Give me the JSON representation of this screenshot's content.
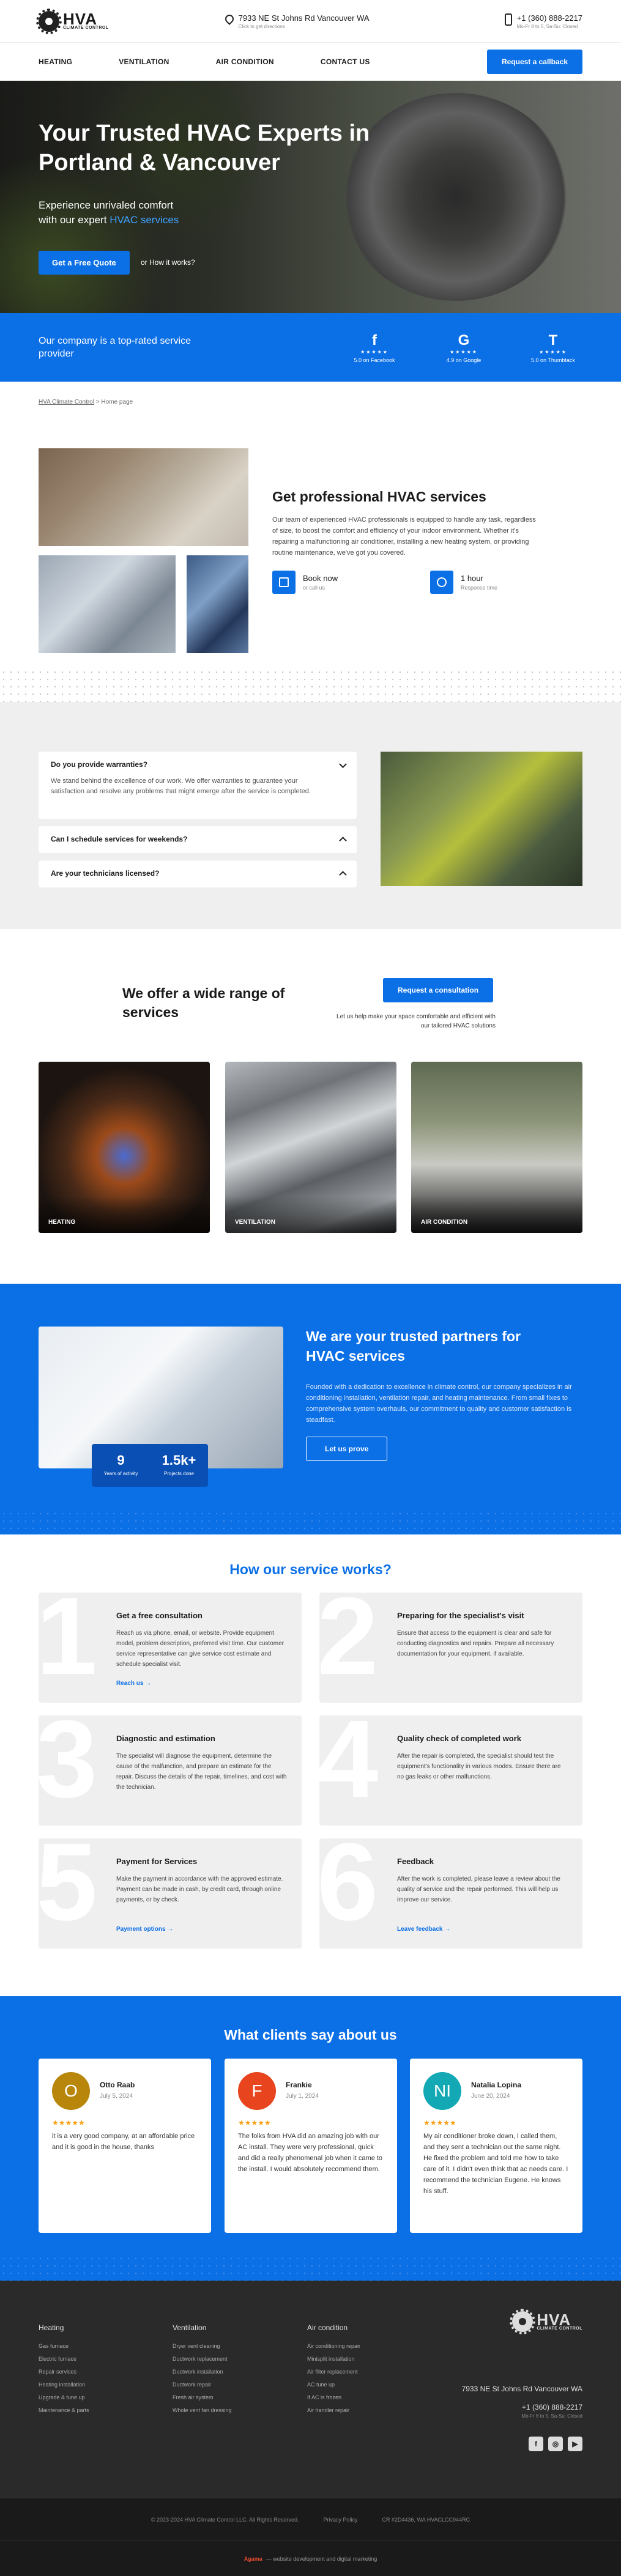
{
  "header": {
    "logo_title": "HVA",
    "logo_sub": "CLIMATE CONTROL",
    "address": "7933 NE St Johns Rd Vancouver WA",
    "address_sub": "Click to get directions",
    "phone": "+1 (360) 888-2217",
    "phone_sub": "Mo-Fr 8 to 5, Sa-Su: Closed"
  },
  "nav": {
    "items": [
      "HEATING",
      "VENTILATION",
      "AIR CONDITION",
      "CONTACT US"
    ],
    "callback": "Request a callback"
  },
  "hero": {
    "title": "Your Trusted HVAC Experts in Portland & Vancouver",
    "lead1": "Experience unrivaled comfort",
    "lead2": "with our expert",
    "lead_accent": "HVAC services",
    "cta": "Get a Free Quote",
    "or": "or  How it works?"
  },
  "rating": {
    "title": "Our company is a top-rated service provider",
    "items": [
      {
        "logo": "f",
        "stars": "★★★★★",
        "caption": "5.0 on Facebook"
      },
      {
        "logo": "G",
        "stars": "★★★★★",
        "caption": "4.9 on Google"
      },
      {
        "logo": "T",
        "stars": "★★★★★",
        "caption": "5.0 on Thumbtack"
      }
    ]
  },
  "breadcrumb": {
    "home": "HVA Climate Control",
    "current": " > Home page"
  },
  "pro": {
    "title": "Get professional HVAC services",
    "text": "Our team of experienced HVAC professionals is equipped to handle any task, regardless of size, to boost the comfort and efficiency of your indoor environment. Whether it's repairing a malfunctioning air conditioner, installing a new heating system, or providing routine maintenance, we've got you covered.",
    "f1_title": "Book now",
    "f1_sub": "or call us",
    "f2_title": "1 hour",
    "f2_sub": "Response time"
  },
  "faq": {
    "items": [
      {
        "q": "Do you provide warranties?",
        "a": "We stand behind the excellence of our work. We offer warranties to guarantee your satisfaction and resolve any problems that might emerge after the service is completed."
      },
      {
        "q": "Can I schedule services for weekends?"
      },
      {
        "q": "Are your technicians licensed?"
      }
    ]
  },
  "services": {
    "title": "We offer a wide range of services",
    "cta": "Request a consultation",
    "note": "Let us help make your space comfortable and efficient with our tailored HVAC solutions",
    "items": [
      "HEATING",
      "VENTILATION",
      "AIR CONDITION"
    ]
  },
  "trusted": {
    "title": "We are your trusted partners for HVAC services",
    "text": "Founded with a dedication to excellence in climate control, our company specializes in air conditioning installation, ventilation repair, and heating maintenance. From small fixes to comprehensive system overhauls, our commitment to quality and customer satisfaction is steadfast.",
    "cta": "Let us prove",
    "stat1_num": "9",
    "stat1_lbl": "Years of activity",
    "stat2_num": "1.5k+",
    "stat2_lbl": "Projects done"
  },
  "how": {
    "title": "How our service works?",
    "steps": [
      {
        "n": "1",
        "title": "Get a free consultation",
        "text": "Reach us via phone, email, or website. Provide equipment model, problem description, preferred visit time. Our customer service representative can give service cost estimate and schedule specialist visit.",
        "link": "Reach us →"
      },
      {
        "n": "2",
        "title": "Preparing for the specialist's visit",
        "text": "Ensure that access to the equipment is clear and safe for conducting diagnostics and repairs. Prepare all necessary documentation for your equipment, if available."
      },
      {
        "n": "3",
        "title": "Diagnostic and estimation",
        "text": "The specialist will diagnose the equipment, determine the cause of the malfunction, and prepare an estimate for the repair. Discuss the details of the repair, timelines, and cost with the technician."
      },
      {
        "n": "4",
        "title": "Quality check of completed work",
        "text": "After the repair is completed, the specialist should test the equipment's functionality in various modes. Ensure there are no gas leaks or other malfunctions."
      },
      {
        "n": "5",
        "title": "Payment for Services",
        "text": "Make the payment in accordance with the approved estimate. Payment can be made in cash, by credit card, through online payments, or by check.",
        "link": "Payment options →"
      },
      {
        "n": "6",
        "title": "Feedback",
        "text": "After the work is completed, please leave a review about the quality of service and the repair performed. This will help us improve our service.",
        "link": "Leave feedback →"
      }
    ]
  },
  "clients": {
    "title": "What clients say about us",
    "reviews": [
      {
        "initial": "O",
        "color": "#b8860b",
        "name": "Otto Raab",
        "date": "July 5, 2024",
        "stars": "★★★★★",
        "text": "it is a very good company, at an affordable price and it is good in the house, thanks"
      },
      {
        "initial": "F",
        "color": "#e8441d",
        "name": "Frankie",
        "date": "July 1, 2024",
        "stars": "★★★★★",
        "text": "The folks from HVA did an amazing job with our AC install. They were very professional, quick and did a really phenomenal job when it came to the install. I would absolutely recommend them."
      },
      {
        "initial": "NI",
        "color": "#12a9b4",
        "name": "Natalia Lopina",
        "date": "June 20, 2024",
        "stars": "★★★★★",
        "text": "My air conditioner broke down, I called them, and they sent a technician out the same night. He fixed the problem and told me how to take care of it. I didn't even think that ac needs care. I recommend the technician Eugene. He knows his stuff."
      }
    ]
  },
  "footer": {
    "cols": [
      {
        "title": "Heating",
        "items": [
          "Gas furnace",
          "Electric furnace",
          "Repair services",
          "Heating installation",
          "Upgrade & tune up",
          "Maintenance & parts"
        ]
      },
      {
        "title": "Ventilation",
        "items": [
          "Dryer vent cleaning",
          "Ductwork replacement",
          "Ductwork installation",
          "Ductwork repair",
          "Fresh air system",
          "Whole vent fan dressing"
        ]
      },
      {
        "title": "Air condition",
        "items": [
          "Air conditioning repair",
          "Minisplit installation",
          "Air filter replacement",
          "AC tune up",
          "If AC is frozen",
          "Air handler repair"
        ]
      }
    ],
    "address": "7933 NE St Johns Rd Vancouver WA",
    "phone": "+1 (360) 888-2217",
    "phone_sub": "Mo-Fr 8 to 5, Sa-Su: Closed",
    "copyright": "© 2023-2024 HVA Climate Control LLC. All Rights Reserved.",
    "privacy": "Privacy Policy",
    "license": "CR #2D4436, WA HVACLCC944RC",
    "credit_brand": "Agama",
    "credit_text": "— website development and digital marketing"
  }
}
